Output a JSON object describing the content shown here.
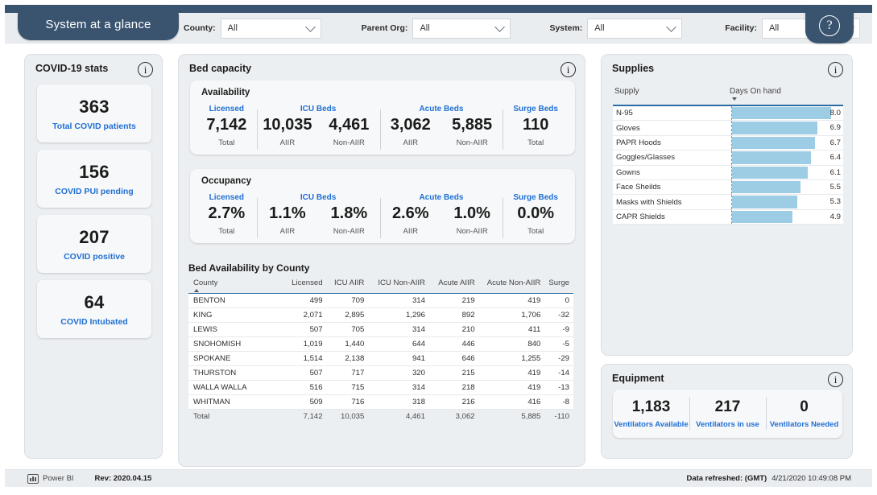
{
  "header": {
    "page_tab_label": "System at a glance",
    "help_icon": "question-mark-icon",
    "filters": [
      {
        "label": "County:",
        "value": "All"
      },
      {
        "label": "Parent Org:",
        "value": "All"
      },
      {
        "label": "System:",
        "value": "All"
      },
      {
        "label": "Facility:",
        "value": "All"
      }
    ]
  },
  "covid_stats": {
    "title": "COVID-19 stats",
    "cards": [
      {
        "value": "363",
        "label": "Total COVID patients"
      },
      {
        "value": "156",
        "label": "COVID PUI pending"
      },
      {
        "value": "207",
        "label": "COVID positive"
      },
      {
        "value": "64",
        "label": "COVID Intubated"
      }
    ]
  },
  "bed_capacity": {
    "title": "Bed capacity",
    "availability": {
      "title": "Availability",
      "groups": [
        {
          "head": "Licensed",
          "kpis": [
            {
              "value": "7,142",
              "sub": "Total"
            }
          ]
        },
        {
          "head": "ICU Beds",
          "kpis": [
            {
              "value": "10,035",
              "sub": "AIIR"
            },
            {
              "value": "4,461",
              "sub": "Non-AIIR"
            }
          ]
        },
        {
          "head": "Acute Beds",
          "kpis": [
            {
              "value": "3,062",
              "sub": "AIIR"
            },
            {
              "value": "5,885",
              "sub": "Non-AIIR"
            }
          ]
        },
        {
          "head": "Surge Beds",
          "kpis": [
            {
              "value": "110",
              "sub": "Total"
            }
          ]
        }
      ]
    },
    "occupancy": {
      "title": "Occupancy",
      "groups": [
        {
          "head": "Licensed",
          "kpis": [
            {
              "value": "2.7%",
              "sub": "Total"
            }
          ]
        },
        {
          "head": "ICU Beds",
          "kpis": [
            {
              "value": "1.1%",
              "sub": "AIIR"
            },
            {
              "value": "1.8%",
              "sub": "Non-AIIR"
            }
          ]
        },
        {
          "head": "Acute Beds",
          "kpis": [
            {
              "value": "2.6%",
              "sub": "AIIR"
            },
            {
              "value": "1.0%",
              "sub": "Non-AIIR"
            }
          ]
        },
        {
          "head": "Surge Beds",
          "kpis": [
            {
              "value": "0.0%",
              "sub": "Total"
            }
          ]
        }
      ]
    },
    "table": {
      "title": "Bed Availability by County",
      "columns": [
        "County",
        "Licensed",
        "ICU AIIR",
        "ICU Non-AIIR",
        "Acute AIIR",
        "Acute Non-AIIR",
        "Surge"
      ],
      "sorted_by": "County",
      "sort_direction": "asc",
      "rows": [
        [
          "BENTON",
          "499",
          "709",
          "314",
          "219",
          "419",
          "0"
        ],
        [
          "KING",
          "2,071",
          "2,895",
          "1,296",
          "892",
          "1,706",
          "-32"
        ],
        [
          "LEWIS",
          "507",
          "705",
          "314",
          "210",
          "411",
          "-9"
        ],
        [
          "SNOHOMISH",
          "1,019",
          "1,440",
          "644",
          "446",
          "840",
          "-5"
        ],
        [
          "SPOKANE",
          "1,514",
          "2,138",
          "941",
          "646",
          "1,255",
          "-29"
        ],
        [
          "THURSTON",
          "507",
          "717",
          "320",
          "215",
          "419",
          "-14"
        ],
        [
          "WALLA WALLA",
          "516",
          "715",
          "314",
          "218",
          "419",
          "-13"
        ],
        [
          "WHITMAN",
          "509",
          "716",
          "318",
          "216",
          "416",
          "-8"
        ]
      ],
      "total_row": [
        "Total",
        "7,142",
        "10,035",
        "4,461",
        "3,062",
        "5,885",
        "-110"
      ]
    }
  },
  "supplies": {
    "title": "Supplies",
    "columns": [
      "Supply",
      "Days On hand"
    ],
    "sorted_by": "Days On hand",
    "sort_direction": "desc",
    "bar_color": "#9ccde4",
    "rows": [
      {
        "name": "N-95",
        "value": "8.0",
        "num": 8.0
      },
      {
        "name": "Gloves",
        "value": "6.9",
        "num": 6.9
      },
      {
        "name": "PAPR Hoods",
        "value": "6.7",
        "num": 6.7
      },
      {
        "name": "Goggles/Glasses",
        "value": "6.4",
        "num": 6.4
      },
      {
        "name": "Gowns",
        "value": "6.1",
        "num": 6.1
      },
      {
        "name": "Face Sheilds",
        "value": "5.5",
        "num": 5.5
      },
      {
        "name": "Masks with Shields",
        "value": "5.3",
        "num": 5.3
      },
      {
        "name": "CAPR Shields",
        "value": "4.9",
        "num": 4.9
      }
    ]
  },
  "equipment": {
    "title": "Equipment",
    "cells": [
      {
        "value": "1,183",
        "label": "Ventilators Available"
      },
      {
        "value": "217",
        "label": "Ventilators in use"
      },
      {
        "value": "0",
        "label": "Ventilators Needed"
      }
    ]
  },
  "footer": {
    "powerbi_label": "Power BI",
    "revision": "Rev: 2020.04.15",
    "refresh_label": "Data refreshed: (GMT)",
    "refresh_value": "4/21/2020 10:49:08 PM"
  },
  "theme": {
    "navy": "#3a5470",
    "accent_blue": "#1f6fd4",
    "rule_blue": "#2b6ca3",
    "panel_bg": "#eceff2"
  }
}
